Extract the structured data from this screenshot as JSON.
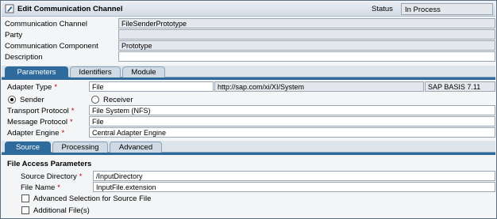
{
  "header": {
    "title": "Edit Communication Channel",
    "status_label": "Status",
    "status_value": "In Process"
  },
  "general": {
    "channel_label": "Communication Channel",
    "channel_value": "FileSenderPrototype",
    "party_label": "Party",
    "party_value": "",
    "component_label": "Communication Component",
    "component_value": "Prototype",
    "description_label": "Description",
    "description_value": ""
  },
  "main_tabs": [
    "Parameters",
    "Identifiers",
    "Module"
  ],
  "adapter": {
    "type_label": "Adapter Type",
    "type_value": "File",
    "namespace": "http://sap.com/xi/XI/System",
    "swcv": "SAP BASIS 7.11",
    "sender_label": "Sender",
    "receiver_label": "Receiver",
    "transport_label": "Transport Protocol",
    "transport_value": "File System (NFS)",
    "message_label": "Message Protocol",
    "message_value": "File",
    "engine_label": "Adapter Engine",
    "engine_value": "Central Adapter Engine"
  },
  "sub_tabs": [
    "Source",
    "Processing",
    "Advanced"
  ],
  "source": {
    "section_title": "File Access Parameters",
    "dir_label": "Source Directory",
    "dir_value": "/InputDirectory",
    "name_label": "File Name",
    "name_value": "InputFile.extension",
    "adv_selection_label": "Advanced Selection for Source File",
    "additional_files_label": "Additional File(s)"
  },
  "colors": {
    "accent": "#2e6a9c",
    "required": "#c00000"
  }
}
